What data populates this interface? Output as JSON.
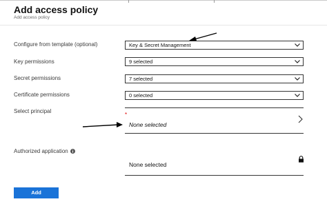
{
  "header": {
    "title": "Add access policy",
    "subtitle": "Add access policy"
  },
  "fields": {
    "template": {
      "label": "Configure from template (optional)",
      "value": "Key & Secret Management"
    },
    "key_permissions": {
      "label": "Key permissions",
      "value": "9 selected"
    },
    "secret_permissions": {
      "label": "Secret permissions",
      "value": "7 selected"
    },
    "certificate_permissions": {
      "label": "Certificate permissions",
      "value": "0 selected"
    },
    "principal": {
      "label": "Select principal",
      "required_marker": "*",
      "value": "None selected"
    },
    "authorized_application": {
      "label": "Authorized application",
      "value": "None selected"
    }
  },
  "actions": {
    "add_label": "Add"
  },
  "icons": {
    "dropdown": "chevron-down-icon",
    "principal": "chevron-right-icon",
    "info": "info-icon",
    "lock": "lock-icon"
  },
  "colors": {
    "primary_button": "#1a73d8",
    "required": "#e00000"
  }
}
